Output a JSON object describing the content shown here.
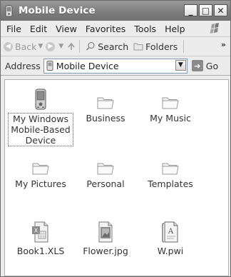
{
  "window": {
    "title": "Mobile Device"
  },
  "title_buttons": {
    "minimize": "_",
    "maximize": "□",
    "close": "✕"
  },
  "menubar": {
    "items": [
      "File",
      "Edit",
      "View",
      "Favorites",
      "Tools",
      "Help"
    ]
  },
  "toolbar": {
    "back_label": "Back",
    "search_label": "Search",
    "folders_label": "Folders",
    "more": "»"
  },
  "address": {
    "label": "Address",
    "value": "Mobile Device",
    "go_label": "Go"
  },
  "items": [
    {
      "label": "My Windows Mobile-Based Device",
      "icon": "device-icon",
      "selected": true
    },
    {
      "label": "Business",
      "icon": "folder-icon"
    },
    {
      "label": "My Music",
      "icon": "folder-icon"
    },
    {
      "label": "My Pictures",
      "icon": "folder-icon"
    },
    {
      "label": "Personal",
      "icon": "folder-icon"
    },
    {
      "label": "Templates",
      "icon": "folder-icon"
    },
    {
      "label": "Book1.XLS",
      "icon": "excel-file-icon"
    },
    {
      "label": "Flower.jpg",
      "icon": "image-file-icon"
    },
    {
      "label": "W.pwi",
      "icon": "pocket-word-file-icon"
    }
  ]
}
